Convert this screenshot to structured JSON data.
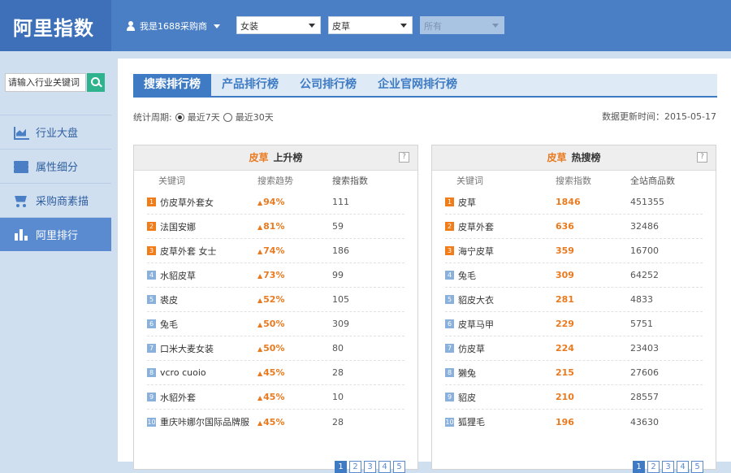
{
  "app": {
    "logo": "阿里指数",
    "user": "我是1688采购商"
  },
  "filters": {
    "category1": "女装",
    "category2": "皮草",
    "category3": "所有"
  },
  "sidebar": {
    "search_placeholder": "请输入行业关键词",
    "items": [
      {
        "label": "行业大盘",
        "icon": "trend-chart-icon"
      },
      {
        "label": "属性细分",
        "icon": "layers-icon"
      },
      {
        "label": "采购商素描",
        "icon": "cart-icon"
      },
      {
        "label": "阿里排行",
        "icon": "bar-chart-icon",
        "active": true
      }
    ]
  },
  "tabs": [
    "搜索排行榜",
    "产品排行榜",
    "公司排行榜",
    "企业官网排行榜"
  ],
  "period": {
    "label": "统计周期:",
    "option1": "最近7天",
    "option2": "最近30天"
  },
  "update": "数据更新时间：2015-05-17",
  "rising": {
    "category": "皮草",
    "title": "上升榜",
    "cols": [
      "关键词",
      "搜索趋势",
      "搜索指数"
    ],
    "rows": [
      {
        "rank": "1",
        "kw": "仿皮草外套女",
        "trend": "94%",
        "idx": "111"
      },
      {
        "rank": "2",
        "kw": "法国安娜",
        "trend": "81%",
        "idx": "59"
      },
      {
        "rank": "3",
        "kw": "皮草外套 女士",
        "trend": "74%",
        "idx": "186"
      },
      {
        "rank": "4",
        "kw": "水貂皮草",
        "trend": "73%",
        "idx": "99"
      },
      {
        "rank": "5",
        "kw": "裘皮",
        "trend": "52%",
        "idx": "105"
      },
      {
        "rank": "6",
        "kw": "兔毛",
        "trend": "50%",
        "idx": "309"
      },
      {
        "rank": "7",
        "kw": "口米大麦女装",
        "trend": "50%",
        "idx": "80"
      },
      {
        "rank": "8",
        "kw": "vcro cuoio",
        "trend": "45%",
        "idx": "28"
      },
      {
        "rank": "9",
        "kw": "水貂外套",
        "trend": "45%",
        "idx": "10"
      },
      {
        "rank": "10",
        "kw": "重庆咔娜尔国际品牌服",
        "trend": "45%",
        "idx": "28"
      }
    ],
    "pages": [
      "1",
      "2",
      "3",
      "4",
      "5"
    ]
  },
  "hot": {
    "category": "皮草",
    "title": "热搜榜",
    "cols": [
      "关键词",
      "搜索指数",
      "全站商品数"
    ],
    "rows": [
      {
        "rank": "1",
        "kw": "皮草",
        "idx": "1846",
        "count": "451355"
      },
      {
        "rank": "2",
        "kw": "皮草外套",
        "idx": "636",
        "count": "32486"
      },
      {
        "rank": "3",
        "kw": "海宁皮草",
        "idx": "359",
        "count": "16700"
      },
      {
        "rank": "4",
        "kw": "兔毛",
        "idx": "309",
        "count": "64252"
      },
      {
        "rank": "5",
        "kw": "貂皮大衣",
        "idx": "281",
        "count": "4833"
      },
      {
        "rank": "6",
        "kw": "皮草马甲",
        "idx": "229",
        "count": "5751"
      },
      {
        "rank": "7",
        "kw": "仿皮草",
        "idx": "224",
        "count": "23403"
      },
      {
        "rank": "8",
        "kw": "獭兔",
        "idx": "215",
        "count": "27606"
      },
      {
        "rank": "9",
        "kw": "貂皮",
        "idx": "210",
        "count": "28557"
      },
      {
        "rank": "10",
        "kw": "狐狸毛",
        "idx": "196",
        "count": "43630"
      }
    ],
    "pages": [
      "1",
      "2",
      "3",
      "4",
      "5"
    ]
  }
}
